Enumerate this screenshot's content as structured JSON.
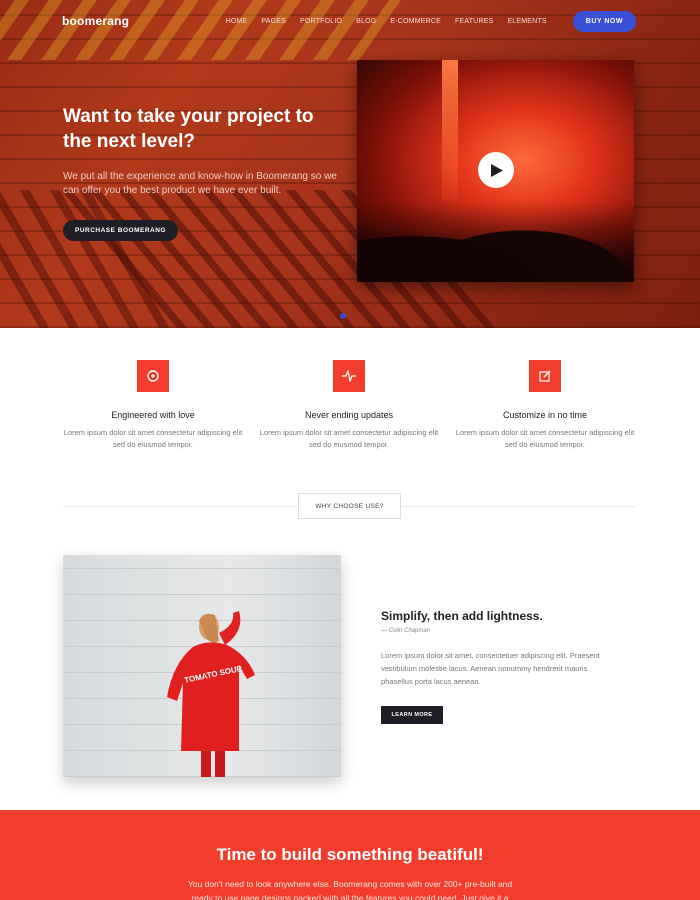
{
  "brand": {
    "logo": "boomerang"
  },
  "nav": {
    "items": [
      "HOME",
      "PAGES",
      "PORTFOLIO",
      "BLOG",
      "E-COMMERCE",
      "FEATURES",
      "ELEMENTS"
    ],
    "buy_label": "BUY NOW"
  },
  "hero": {
    "title": "Want to take your project to the next level?",
    "text": "We put all the experience and know-how in Boomerang so we can offer you the best product we have ever built.",
    "button": "PURCHASE BOOMERANG",
    "play_icon": "play-icon",
    "slider_active": 1
  },
  "features": [
    {
      "icon": "disc-icon",
      "title": "Engineered with love",
      "text": "Lorem ipsum dolor sit amet consectetur adipiscing elit sed do eiusmod tempor."
    },
    {
      "icon": "pulse-icon",
      "title": "Never ending updates",
      "text": "Lorem ipsum dolor sit amet consectetur adipiscing elit sed do eiusmod tempor."
    },
    {
      "icon": "edit-icon",
      "title": "Customize in no time",
      "text": "Lorem ipsum dolor sit amet consectetur adipiscing elit sed do eiusmod tempor."
    }
  ],
  "why": {
    "label": "WHY CHOOSE USE?"
  },
  "about": {
    "title": "Simplify, then add lightness.",
    "quote": "—  Colin Chapman",
    "text": "Lorem ipsum dolor sit amet, consectetuer adipiscing elit. Praesent vestibulum molestie lacus. Aenean nonummy hendrerit mauris phasellus porta lacus aenean.",
    "button": "LEARN MORE",
    "photo_shirt_text": "TOMATO SOUP"
  },
  "cta": {
    "title": "Time to build something beatiful!",
    "text": "You don't need to look anywhere else. Boomerang comes with over 200+ pre-built and ready to use page designs packed with all the features you could need. Just give it a try!"
  },
  "colors": {
    "accent": "#f23d2c",
    "primary": "#3a4fd8",
    "dark": "#1e1f26"
  }
}
